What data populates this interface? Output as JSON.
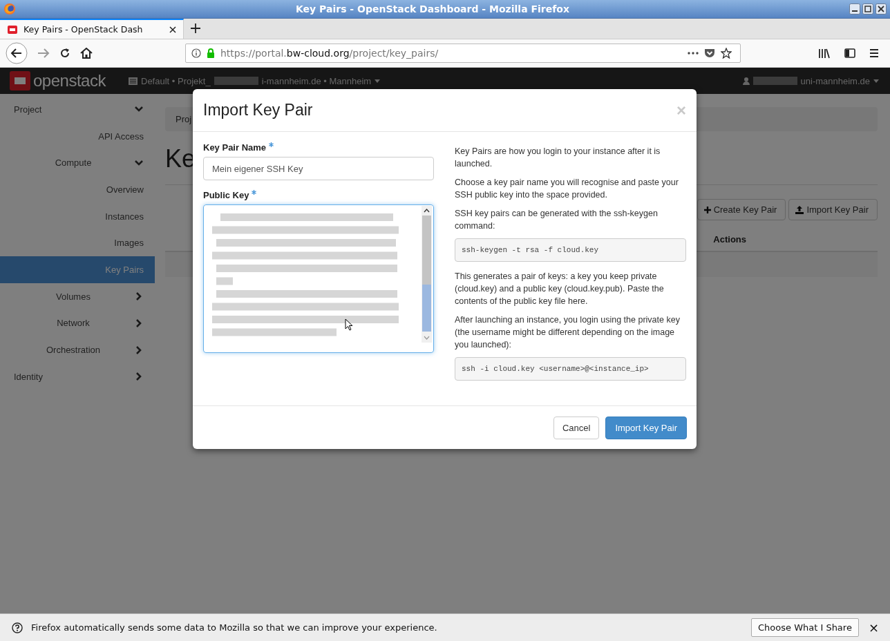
{
  "window": {
    "title": "Key Pairs - OpenStack Dashboard - Mozilla Firefox"
  },
  "browser": {
    "tabs": [
      {
        "label": "Key Pairs - OpenStack Dash",
        "selected": true
      }
    ],
    "url": {
      "scheme": "https://portal.",
      "domain": "bw-cloud.org",
      "path": "/project/key_pairs/"
    }
  },
  "header": {
    "logo": "openstack",
    "project_prefix": "Default • Projekt_",
    "project_suffix": "i-mannheim.de • Mannheim",
    "user_suffix": "uni-mannheim.de"
  },
  "sidebar": {
    "items": [
      {
        "label": "Project",
        "selected": false,
        "expanded": true,
        "children": [
          {
            "label": "API Access",
            "selected": false
          },
          {
            "label": "Compute",
            "selected": false,
            "expanded": true,
            "children": [
              {
                "label": "Overview",
                "selected": false
              },
              {
                "label": "Instances",
                "selected": false
              },
              {
                "label": "Images",
                "selected": false
              },
              {
                "label": "Key Pairs",
                "selected": true
              }
            ]
          },
          {
            "label": "Volumes",
            "selected": false,
            "expanded": false
          },
          {
            "label": "Network",
            "selected": false,
            "expanded": false
          },
          {
            "label": "Orchestration",
            "selected": false,
            "expanded": false
          }
        ]
      },
      {
        "label": "Identity",
        "selected": false,
        "expanded": false
      }
    ]
  },
  "page": {
    "breadcrumb": "Proj",
    "heading": "Ke",
    "actions": [
      {
        "label": "Create Key Pair",
        "kind": "create"
      },
      {
        "label": "Import Key Pair",
        "kind": "import"
      }
    ],
    "table": {
      "columns": [
        "Actions"
      ]
    }
  },
  "modal": {
    "title": "Import Key Pair",
    "close": "×",
    "fields": [
      {
        "label": "Key Pair Name",
        "required": true,
        "kind": "input",
        "value": "Mein eigener SSH Key"
      },
      {
        "label": "Public Key",
        "required": true,
        "kind": "textarea"
      }
    ],
    "help": [
      {
        "kind": "text",
        "text": "Key Pairs are how you login to your instance after it is launched."
      },
      {
        "kind": "text",
        "text": "Choose a key pair name you will recognise and paste your SSH public key into the space provided."
      },
      {
        "kind": "text",
        "text": "SSH key pairs can be generated with the ssh-keygen command:"
      },
      {
        "kind": "code",
        "text": "ssh-keygen -t rsa -f cloud.key"
      },
      {
        "kind": "text",
        "text": "This generates a pair of keys: a key you keep private (cloud.key) and a public key (cloud.key.pub). Paste the contents of the public key file here."
      },
      {
        "kind": "text",
        "text": "After launching an instance, you login using the private key (the username might be different depending on the image you launched):"
      },
      {
        "kind": "code",
        "text": "ssh -i cloud.key <username>@<instance_ip>"
      }
    ],
    "buttons": [
      {
        "label": "Cancel",
        "kind": "default"
      },
      {
        "label": "Import Key Pair",
        "kind": "primary"
      }
    ]
  },
  "notification": {
    "text": "Firefox automatically sends some data to Mozilla so that we can improve your experience.",
    "button": "Choose What I Share",
    "close": "×"
  }
}
